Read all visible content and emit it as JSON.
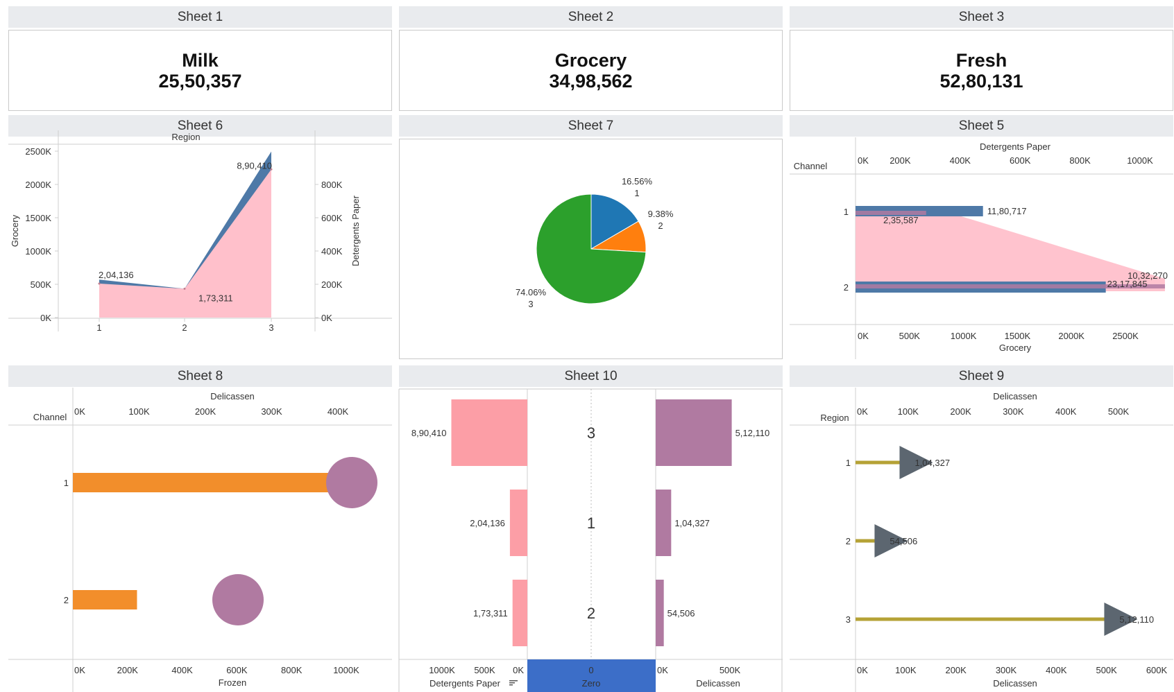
{
  "sheets": {
    "s1": "Sheet 1",
    "s2": "Sheet 2",
    "s3": "Sheet 3",
    "s6": "Sheet 6",
    "s7": "Sheet 7",
    "s5": "Sheet 5",
    "s8": "Sheet 8",
    "s10": "Sheet 10",
    "s9": "Sheet 9"
  },
  "kpis": [
    {
      "label": "Milk",
      "value": "25,50,357"
    },
    {
      "label": "Grocery",
      "value": "34,98,562"
    },
    {
      "label": "Fresh",
      "value": "52,80,131"
    }
  ],
  "colors": {
    "blue": "#4e79a7",
    "pink": "#ffc0cb",
    "mauve": "#b07aa1",
    "orange": "#f28e2b",
    "green": "#2ca02c",
    "pieBlue": "#1f77b4",
    "pieOrange": "#ff7f0e",
    "gold": "#b5a236",
    "slate": "#5c6670",
    "pink2": "#fc9ea6",
    "zeroBlue": "#3c6ec8"
  },
  "chart_data": [
    {
      "id": "sheet6",
      "type": "area",
      "title": "Region",
      "xlabel": "",
      "ylabel": "Grocery",
      "y2label": "Detergents Paper",
      "x": [
        "1",
        "2",
        "3"
      ],
      "ylim": [
        0,
        2500000
      ],
      "y2lim": [
        0,
        1000000
      ],
      "yticks": [
        "0K",
        "500K",
        "1000K",
        "1500K",
        "2000K",
        "2500K"
      ],
      "y2ticks": [
        "0K",
        "200K",
        "400K",
        "600K",
        "800K"
      ],
      "series": [
        {
          "name": "Grocery",
          "values": [
            570221,
            433274,
            2495251
          ],
          "color": "#4e79a7"
        },
        {
          "name": "Detergents Paper",
          "values": [
            204136,
            173311,
            890410
          ],
          "color": "#ffc0cb"
        }
      ],
      "labels": [
        "2,04,136",
        "1,73,311",
        "8,90,410"
      ]
    },
    {
      "id": "sheet7",
      "type": "pie",
      "slices": [
        {
          "label": "1",
          "pct": "16.56%",
          "value": 16.56,
          "color": "#1f77b4"
        },
        {
          "label": "2",
          "pct": "9.38%",
          "value": 9.38,
          "color": "#ff7f0e"
        },
        {
          "label": "3",
          "pct": "74.06%",
          "value": 74.06,
          "color": "#2ca02c"
        }
      ]
    },
    {
      "id": "sheet5",
      "type": "bar",
      "ylabel": "Channel",
      "top_axis_label": "Detergents Paper",
      "bottom_axis_label": "Grocery",
      "categories": [
        "1",
        "2"
      ],
      "top_ticks": [
        "0K",
        "200K",
        "400K",
        "600K",
        "800K",
        "1000K"
      ],
      "bottom_ticks": [
        "0K",
        "500K",
        "1000K",
        "1500K",
        "2000K",
        "2500K"
      ],
      "grocery": [
        1180717,
        2317845
      ],
      "detergents": [
        235587,
        1032270
      ],
      "grocery_labels": [
        "11,80,717",
        "23,17,845"
      ],
      "detergents_labels": [
        "2,35,587",
        "10,32,270"
      ]
    },
    {
      "id": "sheet8",
      "type": "bar",
      "ylabel": "Channel",
      "top_axis_label": "Delicassen",
      "bottom_axis_label": "Frozen",
      "categories": [
        "1",
        "2"
      ],
      "top_ticks": [
        "0K",
        "100K",
        "200K",
        "300K",
        "400K"
      ],
      "bottom_ticks": [
        "0K",
        "200K",
        "400K",
        "600K",
        "800K",
        "1000K"
      ],
      "delicassen": [
        421955,
        248988
      ],
      "frozen": [
        1116979,
        234671
      ]
    },
    {
      "id": "sheet10",
      "type": "bar",
      "categories": [
        "3",
        "1",
        "2"
      ],
      "left_axis_label": "Detergents Paper",
      "mid_axis_label": "Zero",
      "right_axis_label": "Delicassen",
      "left_ticks": [
        "1000K",
        "500K",
        "0K"
      ],
      "mid_tick": "0",
      "right_ticks": [
        "0K",
        "500K"
      ],
      "detergents": [
        890410,
        204136,
        173311
      ],
      "delicassen": [
        512110,
        104327,
        54506
      ],
      "detergents_labels": [
        "8,90,410",
        "2,04,136",
        "1,73,311"
      ],
      "delicassen_labels": [
        "5,12,110",
        "1,04,327",
        "54,506"
      ]
    },
    {
      "id": "sheet9",
      "type": "bar",
      "ylabel": "Region",
      "top_axis_label": "Delicassen",
      "bottom_axis_label": "Delicassen",
      "categories": [
        "1",
        "2",
        "3"
      ],
      "top_ticks": [
        "0K",
        "100K",
        "200K",
        "300K",
        "400K",
        "500K"
      ],
      "bottom_ticks": [
        "0K",
        "100K",
        "200K",
        "300K",
        "400K",
        "500K",
        "600K"
      ],
      "values": [
        104327,
        54506,
        512110
      ],
      "labels": [
        "1,04,327",
        "54,506",
        "5,12,110"
      ]
    }
  ]
}
